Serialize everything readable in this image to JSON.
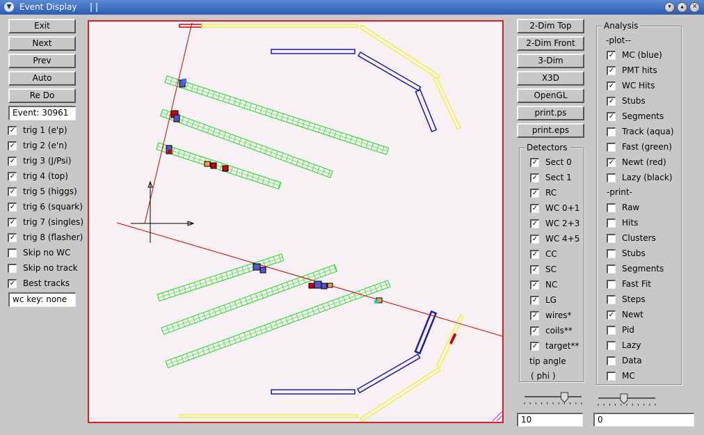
{
  "window": {
    "title": "Event Display",
    "title_icon": "window-menu-icon",
    "controls": [
      "minimize-icon",
      "maximize-icon",
      "close-icon"
    ]
  },
  "left_buttons": [
    {
      "label": "Exit"
    },
    {
      "label": "Next"
    },
    {
      "label": "Prev"
    },
    {
      "label": "Auto"
    },
    {
      "label": "Re Do"
    }
  ],
  "event_field": {
    "value": "Event: 30961"
  },
  "triggers": [
    {
      "label": "trig 1 (e'p)",
      "checked": true
    },
    {
      "label": "trig 2 (e'n)",
      "checked": true
    },
    {
      "label": "trig 3 (J/Psi)",
      "checked": true
    },
    {
      "label": "trig 4 (top)",
      "checked": true
    },
    {
      "label": "trig 5 (higgs)",
      "checked": true
    },
    {
      "label": "trig 6 (squark)",
      "checked": true
    },
    {
      "label": "trig 7 (singles)",
      "checked": true
    },
    {
      "label": "trig 8 (flasher)",
      "checked": true
    },
    {
      "label": "Skip no WC",
      "checked": false
    },
    {
      "label": "Skip no track",
      "checked": false
    },
    {
      "label": "Best tracks",
      "checked": true
    }
  ],
  "wc_key_field": {
    "value": "wc key: none"
  },
  "view_buttons": [
    {
      "label": "2-Dim Top"
    },
    {
      "label": "2-Dim Front"
    },
    {
      "label": "3-Dim"
    },
    {
      "label": "X3D"
    },
    {
      "label": "OpenGL"
    },
    {
      "label": "print.ps"
    },
    {
      "label": "print.eps"
    }
  ],
  "detectors": {
    "title": "Detectors",
    "items": [
      {
        "label": "Sect 0",
        "checked": true
      },
      {
        "label": "Sect 1",
        "checked": true
      },
      {
        "label": "RC",
        "checked": true
      },
      {
        "label": "WC 0+1",
        "checked": true
      },
      {
        "label": "WC 2+3",
        "checked": true
      },
      {
        "label": "WC 4+5",
        "checked": true
      },
      {
        "label": "CC",
        "checked": true
      },
      {
        "label": "SC",
        "checked": true
      },
      {
        "label": "NC",
        "checked": true
      },
      {
        "label": "LG",
        "checked": true
      },
      {
        "label": "wires*",
        "checked": true
      },
      {
        "label": "coils**",
        "checked": true
      },
      {
        "label": "target**",
        "checked": true
      }
    ],
    "tip_angle_label": "tip angle",
    "phi_label": "( phi )"
  },
  "analysis": {
    "title": "Analysis",
    "plot_header": "-plot--",
    "plot_items": [
      {
        "label": "MC (blue)",
        "checked": true
      },
      {
        "label": "PMT hits",
        "checked": true
      },
      {
        "label": "WC Hits",
        "checked": true
      },
      {
        "label": "Stubs",
        "checked": true
      },
      {
        "label": "Segments",
        "checked": true
      },
      {
        "label": "Track (aqua)",
        "checked": false
      },
      {
        "label": "Fast (green)",
        "checked": false
      },
      {
        "label": "Newt (red)",
        "checked": true
      },
      {
        "label": "Lazy (black)",
        "checked": false
      }
    ],
    "print_header": "-print-",
    "print_items": [
      {
        "label": "Raw",
        "checked": false
      },
      {
        "label": "Hits",
        "checked": false
      },
      {
        "label": "Clusters",
        "checked": false
      },
      {
        "label": "Stubs",
        "checked": false
      },
      {
        "label": "Segments",
        "checked": false
      },
      {
        "label": "Fast Fit",
        "checked": false
      },
      {
        "label": "Steps",
        "checked": false
      },
      {
        "label": "Newt",
        "checked": true
      },
      {
        "label": "Pid",
        "checked": false
      },
      {
        "label": "Lazy",
        "checked": false
      },
      {
        "label": "Data",
        "checked": false
      },
      {
        "label": "MC",
        "checked": false
      }
    ]
  },
  "sliders": {
    "tip_angle_value": "10",
    "phi_value": "0",
    "tip_fraction": 0.7,
    "phi_fraction": 0.45
  },
  "colors": {
    "track": "#d00000",
    "wire_chamber": "#22dd22",
    "detector_blue": "#1c1ca8",
    "detector_yellow": "#f2f20a",
    "canvas_bg": "#f7f0f4"
  }
}
